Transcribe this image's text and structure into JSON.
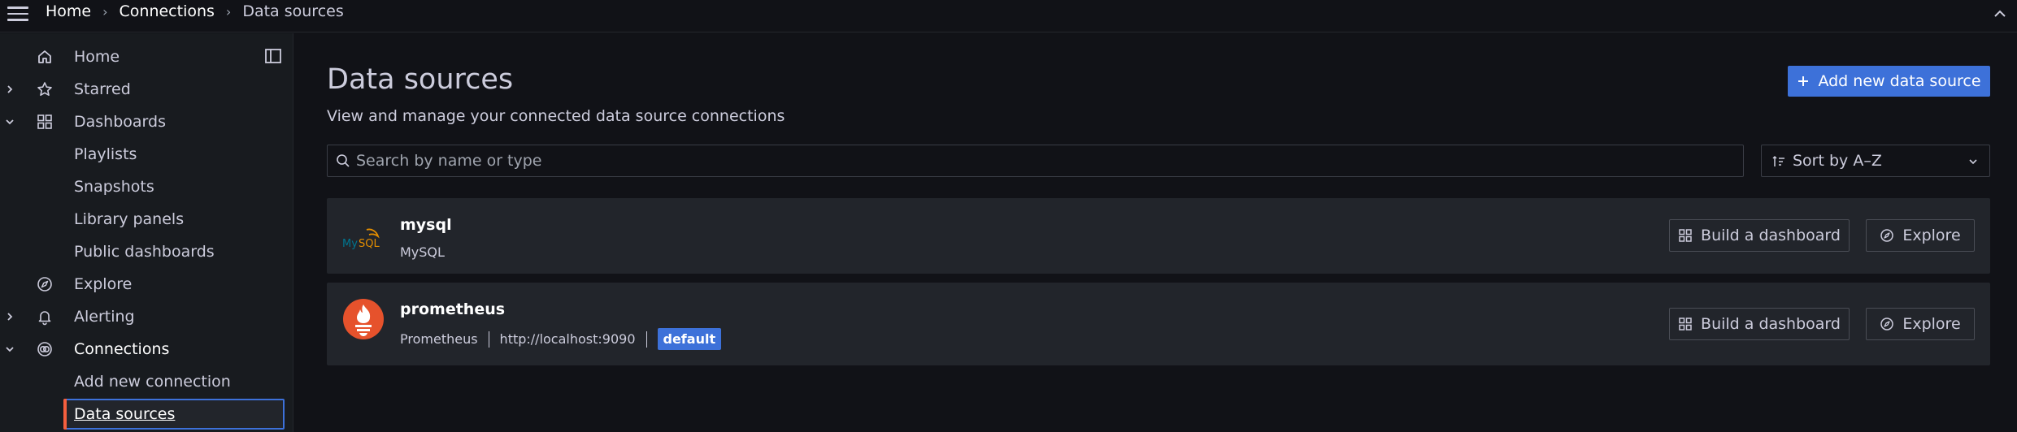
{
  "breadcrumb": {
    "items": [
      "Home",
      "Connections",
      "Data sources"
    ]
  },
  "sidebar": {
    "items": [
      {
        "label": "Home",
        "icon": "home-icon"
      },
      {
        "label": "Starred",
        "icon": "star-icon"
      },
      {
        "label": "Dashboards",
        "icon": "apps-icon"
      },
      {
        "label": "Playlists"
      },
      {
        "label": "Snapshots"
      },
      {
        "label": "Library panels"
      },
      {
        "label": "Public dashboards"
      },
      {
        "label": "Explore",
        "icon": "compass-icon"
      },
      {
        "label": "Alerting",
        "icon": "bell-icon"
      },
      {
        "label": "Connections",
        "icon": "link-icon"
      },
      {
        "label": "Add new connection"
      },
      {
        "label": "Data sources"
      }
    ]
  },
  "page": {
    "title": "Data sources",
    "subtitle": "View and manage your connected data source connections",
    "add_button": "Add new data source"
  },
  "search": {
    "placeholder": "Search by name or type"
  },
  "sort": {
    "label": "Sort by A–Z"
  },
  "datasources": [
    {
      "name": "mysql",
      "type": "MySQL",
      "build": "Build a dashboard",
      "explore": "Explore"
    },
    {
      "name": "prometheus",
      "type": "Prometheus",
      "url": "http://localhost:9090",
      "badge": "default",
      "build": "Build a dashboard",
      "explore": "Explore"
    }
  ],
  "colors": {
    "accent": "#3d71d9",
    "active_marker": "#f55f3e",
    "prometheus": "#e6522c",
    "mysql": "#00758f"
  }
}
